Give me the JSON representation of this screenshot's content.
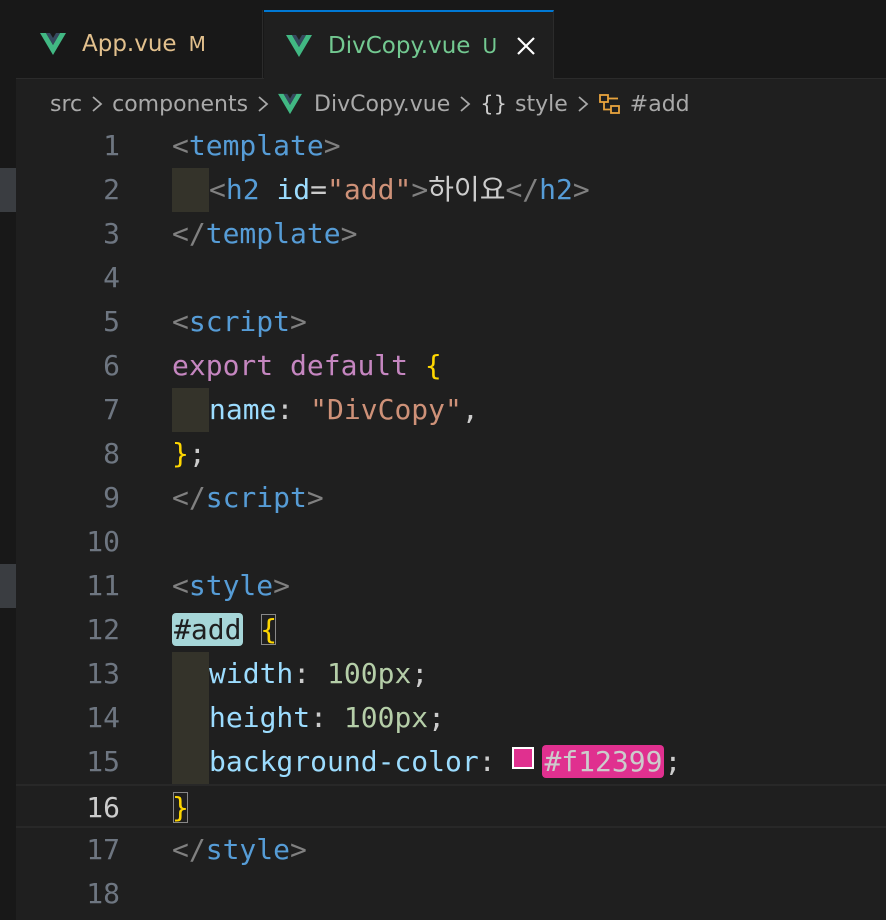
{
  "tabs": [
    {
      "label": "App.vue",
      "badge": "M",
      "icon": "vue-icon",
      "active": false
    },
    {
      "label": "DivCopy.vue",
      "badge": "U",
      "icon": "vue-icon",
      "active": true
    }
  ],
  "breadcrumb": {
    "items": [
      "src",
      "components",
      "DivCopy.vue",
      "style",
      "#add"
    ],
    "braces": "{}"
  },
  "editor": {
    "current_line": 16,
    "color_value": "#f12399",
    "lines": [
      {
        "n": "1"
      },
      {
        "n": "2"
      },
      {
        "n": "3"
      },
      {
        "n": "4"
      },
      {
        "n": "5"
      },
      {
        "n": "6"
      },
      {
        "n": "7"
      },
      {
        "n": "8"
      },
      {
        "n": "9"
      },
      {
        "n": "10"
      },
      {
        "n": "11"
      },
      {
        "n": "12"
      },
      {
        "n": "13"
      },
      {
        "n": "14"
      },
      {
        "n": "15"
      },
      {
        "n": "16"
      },
      {
        "n": "17"
      },
      {
        "n": "18"
      }
    ],
    "code": {
      "l1": {
        "open": "<",
        "tag": "template",
        "close": ">"
      },
      "l2": {
        "open": "<",
        "tag": "h2",
        "attr": "id",
        "eq": "=",
        "val": "\"add\"",
        "gt": ">",
        "text": "하이요",
        "endopen": "</",
        "endtag": "h2",
        "endclose": ">"
      },
      "l3": {
        "open": "</",
        "tag": "template",
        "close": ">"
      },
      "l5": {
        "open": "<",
        "tag": "script",
        "close": ">"
      },
      "l6": {
        "kw1": "export",
        "kw2": "default",
        "brace": "{"
      },
      "l7": {
        "prop": "name",
        "colon": ":",
        "val": "\"DivCopy\"",
        "comma": ","
      },
      "l8": {
        "brace": "}",
        "semi": ";"
      },
      "l9": {
        "open": "</",
        "tag": "script",
        "close": ">"
      },
      "l11": {
        "open": "<",
        "tag": "style",
        "close": ">"
      },
      "l12": {
        "selector": "#add",
        "brace": "{"
      },
      "l13": {
        "prop": "width",
        "colon": ":",
        "val": "100px",
        "semi": ";"
      },
      "l14": {
        "prop": "height",
        "colon": ":",
        "val": "100px",
        "semi": ";"
      },
      "l15": {
        "prop": "background-color",
        "colon": ":",
        "val": "#f12399",
        "semi": ";"
      },
      "l16": {
        "brace": "}"
      },
      "l17": {
        "open": "</",
        "tag": "style",
        "close": ">"
      }
    }
  },
  "colors": {
    "accent": "#0078d4",
    "modified": "#e2c08d",
    "untracked": "#73c991",
    "vue_green": "#41b883",
    "swatch": "#f12399"
  }
}
